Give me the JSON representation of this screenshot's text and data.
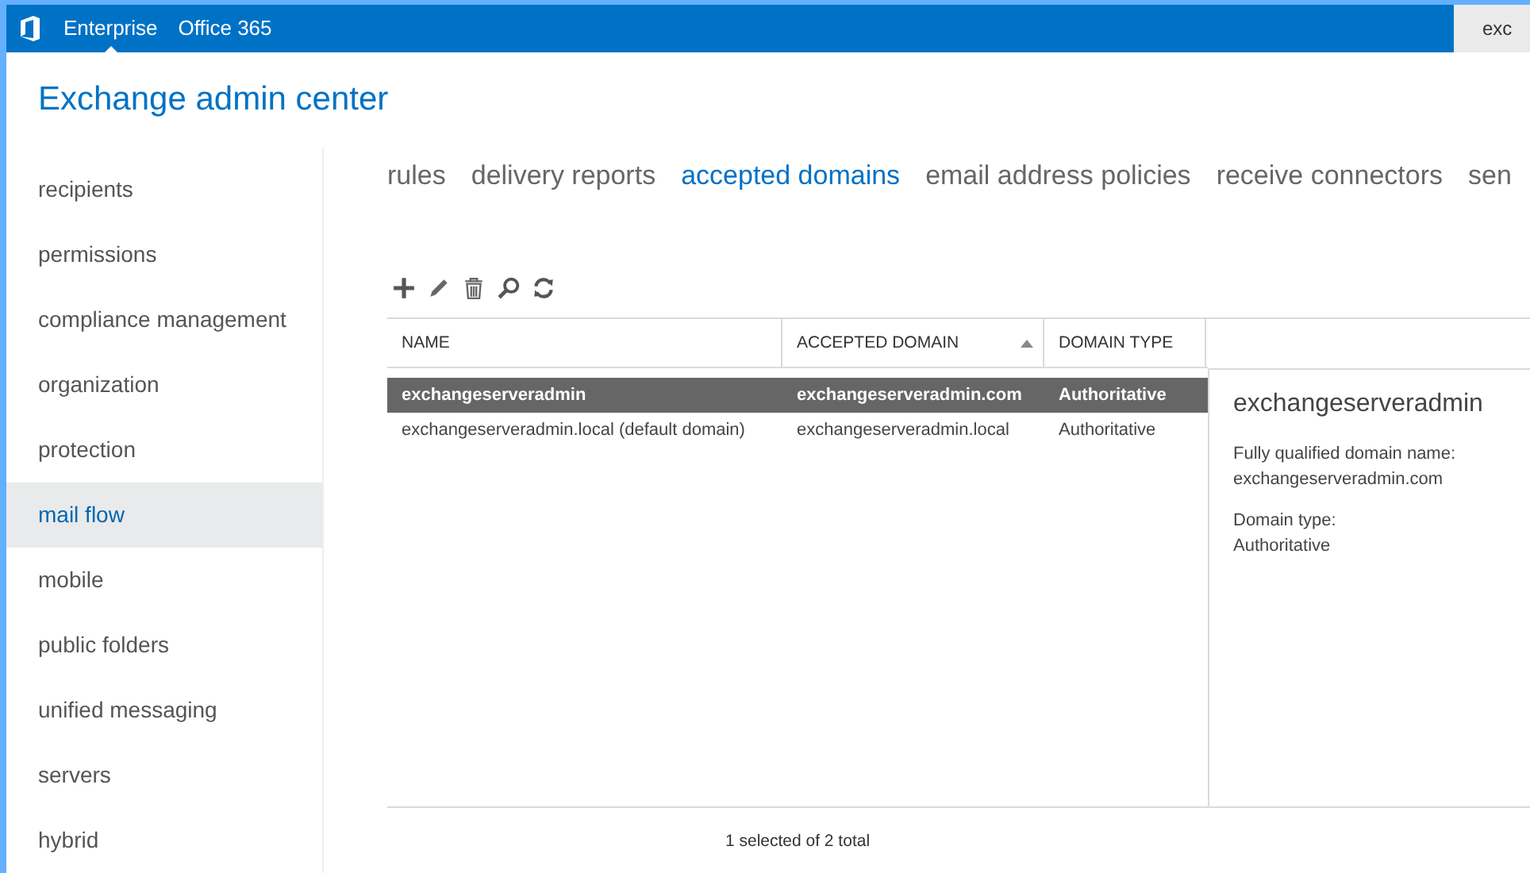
{
  "top_bar": {
    "links": [
      {
        "label": "Enterprise",
        "selected": true
      },
      {
        "label": "Office 365",
        "selected": false
      }
    ],
    "user": "exc"
  },
  "title": "Exchange admin center",
  "sidebar": {
    "items": [
      {
        "label": "recipients",
        "selected": false
      },
      {
        "label": "permissions",
        "selected": false
      },
      {
        "label": "compliance management",
        "selected": false
      },
      {
        "label": "organization",
        "selected": false
      },
      {
        "label": "protection",
        "selected": false
      },
      {
        "label": "mail flow",
        "selected": true
      },
      {
        "label": "mobile",
        "selected": false
      },
      {
        "label": "public folders",
        "selected": false
      },
      {
        "label": "unified messaging",
        "selected": false
      },
      {
        "label": "servers",
        "selected": false
      },
      {
        "label": "hybrid",
        "selected": false
      }
    ]
  },
  "tabs": [
    {
      "label": "rules",
      "selected": false
    },
    {
      "label": "delivery reports",
      "selected": false
    },
    {
      "label": "accepted domains",
      "selected": true
    },
    {
      "label": "email address policies",
      "selected": false
    },
    {
      "label": "receive connectors",
      "selected": false
    },
    {
      "label": "sen",
      "selected": false
    }
  ],
  "table": {
    "columns": [
      {
        "label": "NAME",
        "sorted": false
      },
      {
        "label": "ACCEPTED DOMAIN",
        "sorted": true
      },
      {
        "label": "DOMAIN TYPE",
        "sorted": false
      }
    ],
    "rows": [
      {
        "cells": [
          "exchangeserveradmin",
          "exchangeserveradmin.com",
          "Authoritative"
        ],
        "selected": true
      },
      {
        "cells": [
          "exchangeserveradmin.local (default domain)",
          "exchangeserveradmin.local",
          "Authoritative"
        ],
        "selected": false
      }
    ]
  },
  "details": {
    "title": "exchangeserveradmin",
    "fields": [
      {
        "label": "Fully qualified domain name:",
        "value": "exchangeserveradmin.com"
      },
      {
        "label": "Domain type:",
        "value": "Authoritative"
      }
    ]
  },
  "status_bar": "1 selected of 2 total"
}
